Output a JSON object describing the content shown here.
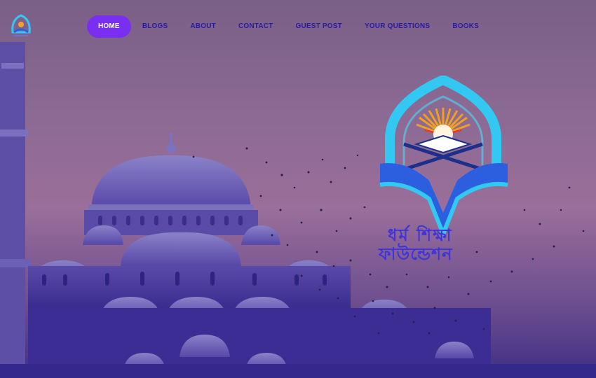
{
  "nav": {
    "items": [
      {
        "label": "HOME",
        "active": true
      },
      {
        "label": "BLOGS"
      },
      {
        "label": "ABOUT"
      },
      {
        "label": "CONTACT"
      },
      {
        "label": "GUEST POST"
      },
      {
        "label": "YOUR QUESTIONS"
      },
      {
        "label": "BOOKS"
      }
    ]
  },
  "brand": {
    "line1": "ধর্ম শিক্ষা",
    "line2": "ফাউন্ডেশন"
  },
  "colors": {
    "accent": "#7a2ff0",
    "nav_text": "#2a1aa8",
    "logo_cyan": "#33c8f2",
    "logo_blue": "#2b5fe0",
    "brand_text": "#3f34d8"
  }
}
